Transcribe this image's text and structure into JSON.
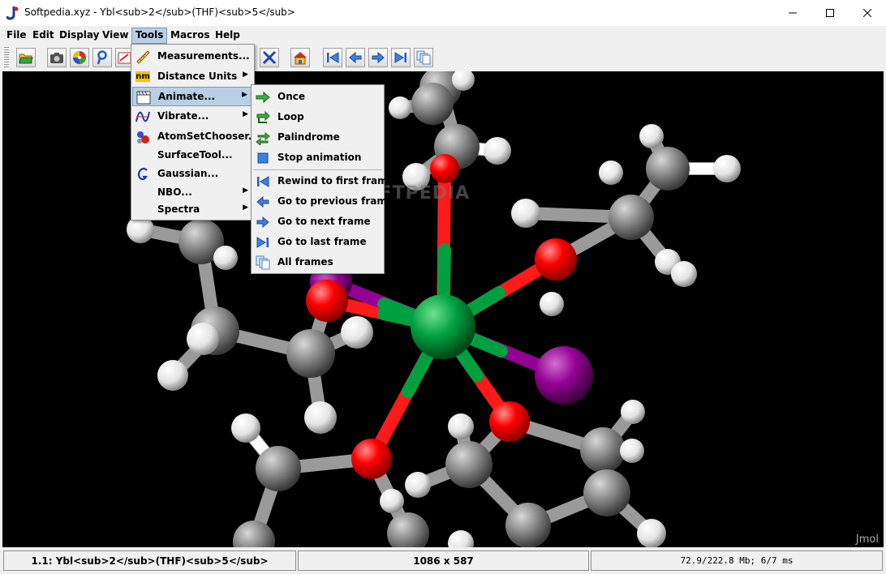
{
  "window": {
    "title": "Softpedia.xyz - Ybl<sub>2</sub>(THF)<sub>5</sub>",
    "minimize_symbol": "—",
    "maximize_symbol": "☐",
    "close_symbol": "✕"
  },
  "menubar": {
    "items": [
      {
        "label": "File"
      },
      {
        "label": "Edit"
      },
      {
        "label": "Display"
      },
      {
        "label": "View"
      },
      {
        "label": "Tools"
      },
      {
        "label": "Macros"
      },
      {
        "label": "Help"
      }
    ],
    "active": "Tools"
  },
  "toolbar": {
    "buttons": [
      "open-icon",
      "camera-icon",
      "color-disc-icon",
      "script-icon",
      "script-editor-icon",
      "shape-icon",
      "rotate-icon",
      "molecule-icon",
      "home-icon",
      "first-frame-icon",
      "previous-frame-icon",
      "next-frame-icon",
      "last-frame-icon",
      "all-frames-icon"
    ]
  },
  "tools_menu": {
    "items": [
      {
        "label": "Measurements...",
        "icon": "ruler-icon",
        "submenu": false
      },
      {
        "label": "Distance Units",
        "icon": "nm-units-icon",
        "icon_text": "nm",
        "submenu": true
      },
      {
        "label": "Animate...",
        "icon": "clapperboard-icon",
        "submenu": true,
        "highlighted": true
      },
      {
        "label": "Vibrate...",
        "icon": "vibrate-wave-icon",
        "submenu": true
      },
      {
        "label": "AtomSetChooser...",
        "icon": "atom-set-icon",
        "submenu": false
      },
      {
        "label": "SurfaceTool...",
        "icon": "",
        "submenu": false
      },
      {
        "label": "Gaussian...",
        "icon": "gaussian-g-icon",
        "submenu": false
      },
      {
        "label": "NBO...",
        "icon": "",
        "submenu": true
      },
      {
        "label": "Spectra",
        "icon": "",
        "submenu": true
      }
    ]
  },
  "animate_menu": {
    "items": [
      {
        "label": "Once",
        "icon": "arrow-right-icon"
      },
      {
        "label": "Loop",
        "icon": "loop-icon"
      },
      {
        "label": "Palindrome",
        "icon": "palindrome-icon"
      },
      {
        "label": "Stop animation",
        "icon": "stop-icon"
      },
      {
        "label": "Rewind to first frame",
        "icon": "rewind-icon"
      },
      {
        "label": "Go to previous frame",
        "icon": "previous-frame-icon"
      },
      {
        "label": "Go to next frame",
        "icon": "next-frame-icon"
      },
      {
        "label": "Go to last frame",
        "icon": "last-frame-icon"
      },
      {
        "label": "All frames",
        "icon": "all-frames-icon"
      }
    ]
  },
  "viewer": {
    "watermark": "SOFTPEDIA",
    "jmol_label": "Jmol"
  },
  "statusbar": {
    "model": "1.1: Ybl<sub>2</sub>(THF)<sub>5</sub>",
    "dimensions": "1086 x 587",
    "memory": "72.9/222.8 Mb;   6/7 ms"
  },
  "colors": {
    "selection": "#b8cfe5",
    "yb_atom": "#00a040",
    "oxygen": "#ff0000",
    "iodine": "#940094",
    "carbon": "#808080",
    "hydrogen": "#ffffff"
  }
}
